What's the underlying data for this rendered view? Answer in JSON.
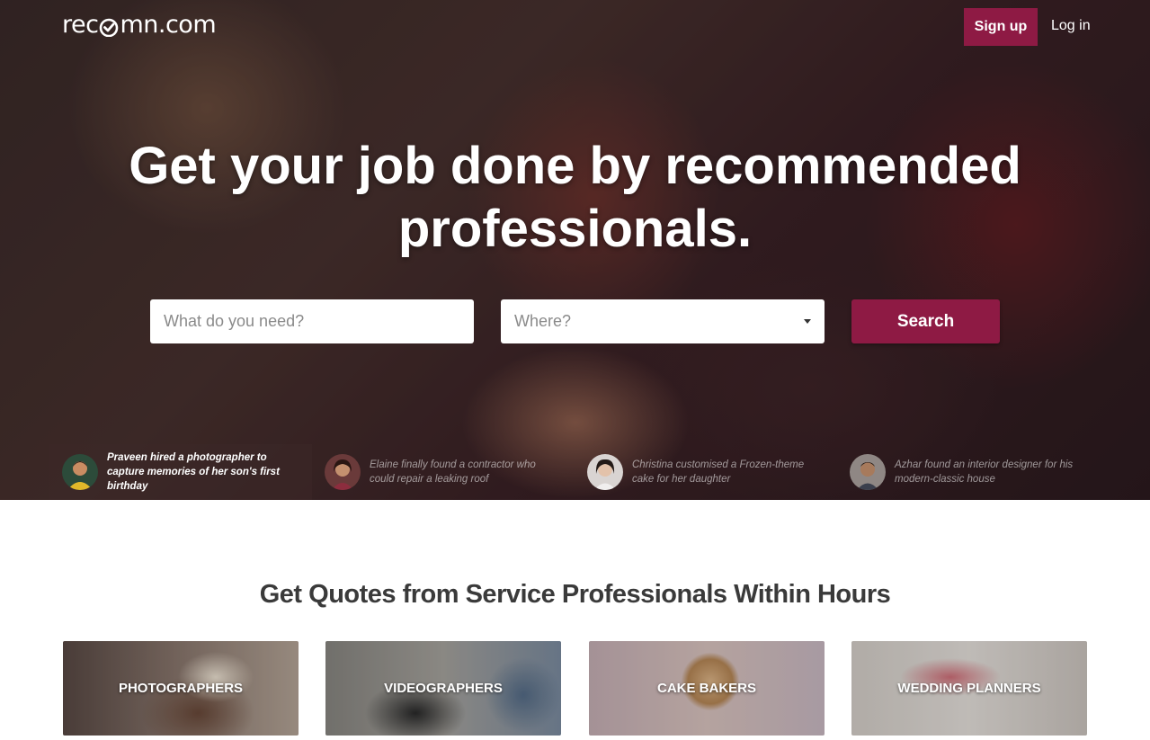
{
  "header": {
    "logo_prefix": "rec",
    "logo_suffix": "mn.com",
    "signup_label": "Sign up",
    "login_label": "Log in"
  },
  "hero": {
    "headline_line1": "Get your job done by recommended",
    "headline_line2": "professionals.",
    "search": {
      "what_placeholder": "What do you need?",
      "where_placeholder": "Where?",
      "button_label": "Search"
    },
    "stories": [
      {
        "text": "Praveen hired a photographer to capture memories of her son's first birthday",
        "active": true
      },
      {
        "text": "Elaine finally found a contractor who could repair a leaking roof",
        "active": false
      },
      {
        "text": "Christina customised a Frozen-theme cake for her daughter",
        "active": false
      },
      {
        "text": "Azhar found an interior designer for his modern-classic house",
        "active": false
      }
    ]
  },
  "section": {
    "title": "Get Quotes from Service Professionals Within Hours",
    "categories": [
      {
        "label": "PHOTOGRAPHERS"
      },
      {
        "label": "VIDEOGRAPHERS"
      },
      {
        "label": "CAKE BAKERS"
      },
      {
        "label": "WEDDING PLANNERS"
      }
    ]
  },
  "colors": {
    "brand": "#8e1a44",
    "text_dark": "#3a3a3a",
    "white": "#ffffff"
  },
  "icons": {
    "logo_check": "check-heart-icon",
    "dropdown": "caret-down-icon"
  }
}
